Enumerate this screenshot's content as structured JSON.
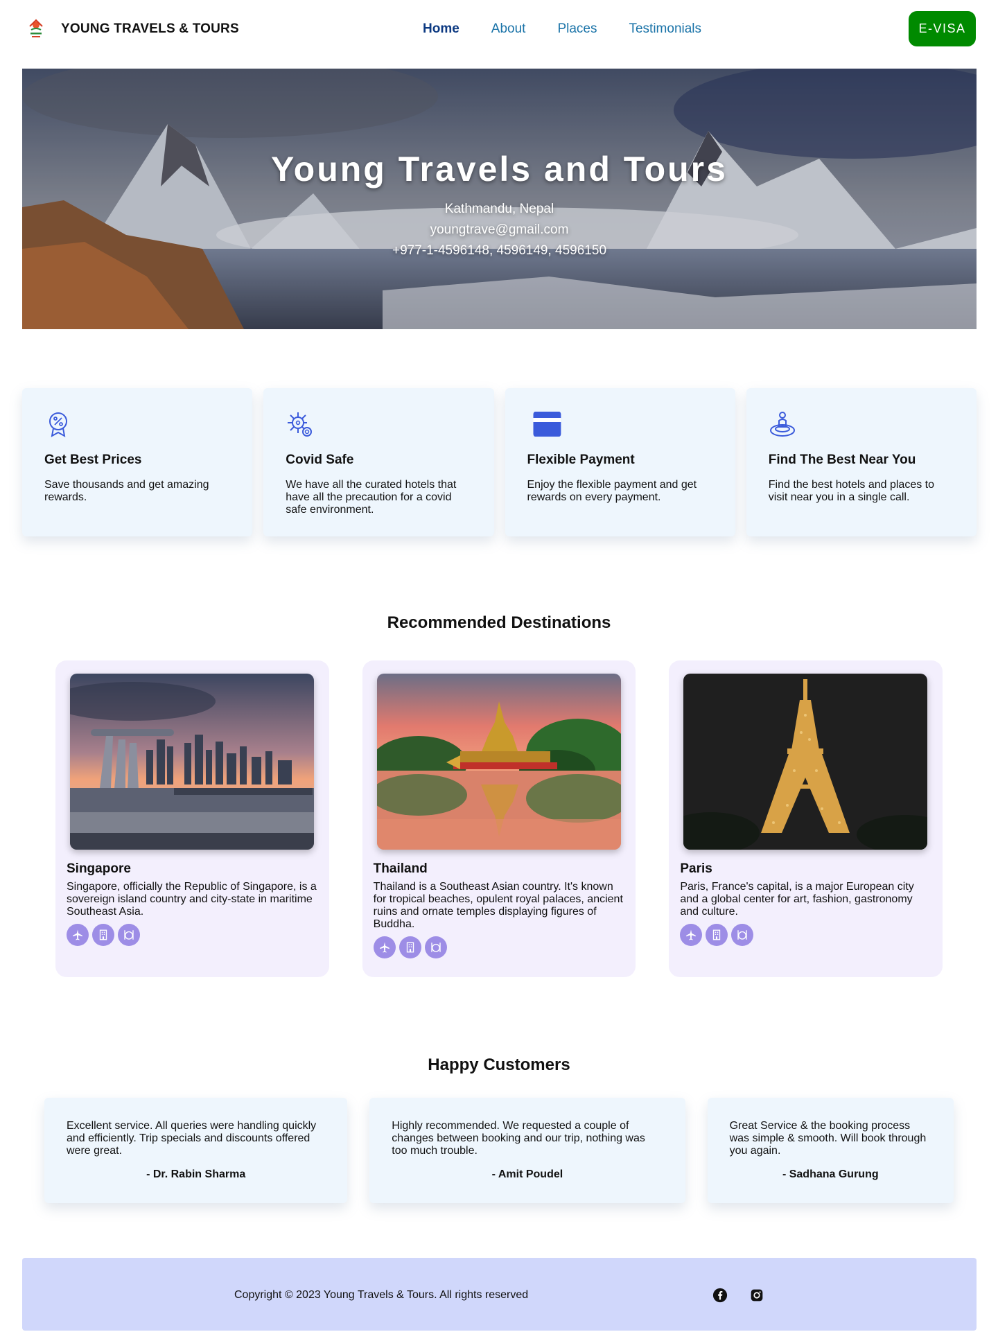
{
  "navbar": {
    "brand_name": "YOUNG TRAVELS & TOURS",
    "links": [
      {
        "label": "Home",
        "active": true
      },
      {
        "label": "About",
        "active": false
      },
      {
        "label": "Places",
        "active": false
      },
      {
        "label": "Testimonials",
        "active": false
      }
    ],
    "evisa_label": "E-VISA"
  },
  "hero": {
    "title": "Young Travels and Tours",
    "location": "Kathmandu, Nepal",
    "email": "youngtrave@gmail.com",
    "phone": "+977-1-4596148, 4596149, 4596150"
  },
  "features": [
    {
      "icon": "discount-badge-icon",
      "title": "Get Best Prices",
      "text": "Save thousands and get amazing rewards."
    },
    {
      "icon": "virus-shield-icon",
      "title": "Covid Safe",
      "text": "We have all the curated hotels that have all the precaution for a covid safe environment."
    },
    {
      "icon": "credit-card-icon",
      "title": "Flexible Payment",
      "text": "Enjoy the flexible payment and get rewards on every payment."
    },
    {
      "icon": "location-pin-icon",
      "title": "Find The Best Near You",
      "text": "Find the best hotels and places to visit near you in a single call."
    }
  ],
  "destinations": {
    "title": "Recommended Destinations",
    "items": [
      {
        "name": "Singapore",
        "text": "Singapore, officially the Republic of Singapore, is a sovereign island country and city-state in maritime Southeast Asia."
      },
      {
        "name": "Thailand",
        "text": "Thailand is a Southeast Asian country. It's known for tropical beaches, opulent royal palaces, ancient ruins and ornate temples displaying figures of Buddha."
      },
      {
        "name": "Paris",
        "text": "Paris, France's capital, is a major European city and a global center for art, fashion, gastronomy and culture."
      }
    ],
    "amenity_icons": [
      "airplane-icon",
      "hotel-icon",
      "food-icon"
    ]
  },
  "testimonials": {
    "title": "Happy Customers",
    "items": [
      {
        "quote": "Excellent service. All queries were handling quickly and efficiently. Trip specials and discounts offered were great.",
        "author": "- Dr. Rabin Sharma"
      },
      {
        "quote": "Highly recommended. We requested a couple of changes between booking and our trip, nothing was too much trouble.",
        "author": "- Amit Poudel"
      },
      {
        "quote": "Great Service & the booking process was simple & smooth. Will book through you again.",
        "author": "- Sadhana Gurung"
      }
    ]
  },
  "footer": {
    "copyright": "Copyright © 2023 Young Travels & Tours. All rights reserved",
    "social_icons": [
      "facebook-icon",
      "instagram-icon"
    ]
  },
  "colors": {
    "accent_green": "#008a00",
    "nav_link": "#1a73a8",
    "nav_active": "#0d3a82",
    "feature_bg": "#eef6fd",
    "destination_bg": "#f3effd",
    "amenity": "#9d8de6",
    "footer_bg": "#d0d7fb",
    "icon_blue": "#3b5bdb"
  }
}
